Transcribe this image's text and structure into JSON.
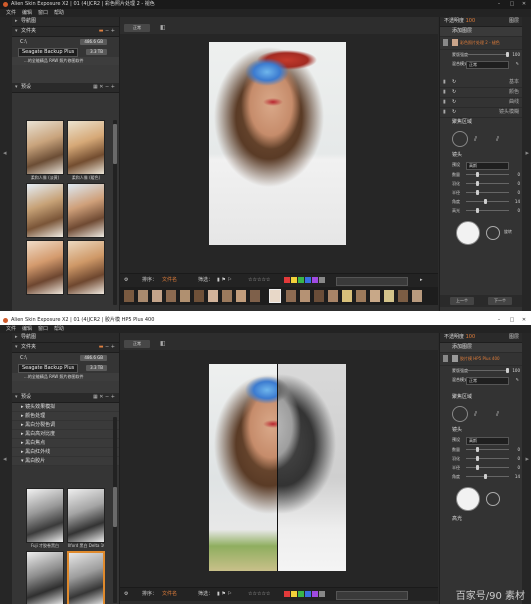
{
  "app": {
    "brand_color": "#d05b2b",
    "accent": "#e08a2c"
  },
  "win1": {
    "title": "Alien Skin Exposure X2 | 01 (4)JCR2 | 彩色照片处理 2 - 褪色",
    "menu": [
      "文件",
      "编辑",
      "窗口",
      "帮助"
    ],
    "left": {
      "nav_label": "导航图",
      "folders_label": "文件夹",
      "drive_c": "C:\\",
      "drive_c_badge": "486.6 GB",
      "backup_label": "Seagate Backup Plus",
      "backup_badge": "3.3 TB",
      "backup_sub": "...的全能精品 RAW 照片修图软件",
      "presets_label": "预设",
      "thumb_captions": [
        "柔和人像 (淡黄)",
        "柔和人像 (暖色)",
        "",
        "",
        "",
        ""
      ]
    },
    "view": {
      "mode_button": "正常",
      "bottom_sort": "排序：",
      "bottom_sort_value": "文件名",
      "bottom_filter": "筛选：",
      "stars": "☆☆☆☆☆",
      "search_placeholder": ""
    },
    "right": {
      "preview_label": "不透明度",
      "preview_value": "100",
      "adjust_label": "添加图层",
      "panels_label": "图层",
      "layer_name": "彩色照片处理 2 - 褪色",
      "mask_label": "蒙版强度",
      "mask_value": "100",
      "blend_label": "混合模式",
      "blend_value": "正常",
      "section1": "基本",
      "section2": "颜色",
      "section3": "曲线",
      "section4": "镜头模糊",
      "section5": "聚焦区域",
      "lens_label": "镜头",
      "preset_label": "预设",
      "preset_value": "高斯",
      "sliders": [
        {
          "name": "数量",
          "value": "0"
        },
        {
          "name": "羽化",
          "value": "0"
        },
        {
          "name": "半径",
          "value": "0"
        },
        {
          "name": "角度",
          "value": "14"
        },
        {
          "name": "高光",
          "value": "0"
        }
      ],
      "rotate_label": "旋转",
      "btn_left": "上一个",
      "btn_right": "下一个"
    }
  },
  "win2": {
    "title": "Alien Skin Exposure X2 | 01 (4)JCR2 | 胶片模 HP5 Plus 400",
    "menu": [
      "文件",
      "编辑",
      "窗口",
      "帮助"
    ],
    "left": {
      "nav_label": "导航图",
      "folders_label": "文件夹",
      "drive_c": "C:\\",
      "drive_c_badge": "486.6 GB",
      "backup_label": "Seagate Backup Plus",
      "backup_badge": "3.3 TB",
      "backup_sub": "...的全能精品 RAW 照片修图软件",
      "presets_label": "预设",
      "tree_items": [
        "镜头效果模拟",
        "颜色处理",
        "黑白分裂色调",
        "黑白高对比度",
        "黑白焦点",
        "黑白红外线",
        "黑白胶片"
      ],
      "thumb_captions": [
        "Fuji 才胶卷黑白",
        "Ilford 黑白 Delta 100",
        "",
        ""
      ]
    },
    "view": {
      "mode_button": "正常",
      "bottom_sort": "排序：",
      "bottom_sort_value": "文件名",
      "bottom_filter": "筛选：",
      "stars": "☆☆☆☆☆"
    },
    "right": {
      "preview_label": "不透明度",
      "preview_value": "100",
      "adjust_label": "添加图层",
      "panels_label": "图层",
      "layer_name": "胶片模 HP5 Plus 400",
      "mask_label": "蒙版强度",
      "mask_value": "100",
      "blend_label": "混合模式",
      "blend_value": "正常",
      "section5": "聚焦区域",
      "lens_label": "镜头",
      "preset_label": "预设",
      "preset_value": "高斯",
      "sliders": [
        {
          "name": "数量",
          "value": "0"
        },
        {
          "name": "羽化",
          "value": "0"
        },
        {
          "name": "半径",
          "value": "0"
        },
        {
          "name": "角度",
          "value": "14"
        }
      ],
      "bottom_label": "高光"
    },
    "watermark": "百家号/90 素材"
  },
  "colors": {
    "swatches": [
      "#e23a3a",
      "#f2d13a",
      "#3ab54a",
      "#3a6fe2",
      "#a04ae2",
      "#888888"
    ]
  }
}
